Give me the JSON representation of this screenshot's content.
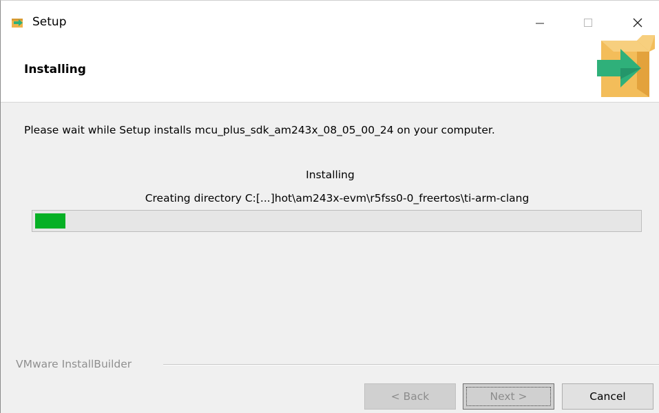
{
  "window": {
    "title": "Setup",
    "icon": "installer-box-icon",
    "controls": [
      "minimize-icon",
      "maximize-icon",
      "close-icon"
    ]
  },
  "header": {
    "title": "Installing",
    "logo": "installer-box-arrow-icon"
  },
  "body": {
    "wait_message": "Please wait while Setup installs mcu_plus_sdk_am243x_08_05_00_24 on your computer.",
    "status_label": "Installing",
    "status_detail": "Creating directory C:[...]hot\\am243x-evm\\r5fss0-0_freertos\\ti-arm-clang",
    "progress_percent": 5
  },
  "footer": {
    "brand": "VMware InstallBuilder",
    "back_label": "< Back",
    "next_label": "Next >",
    "cancel_label": "Cancel"
  },
  "colors": {
    "progress_fill": "#06b025",
    "logo_box": "#f0b34a",
    "logo_arrow": "#2fb07a"
  }
}
